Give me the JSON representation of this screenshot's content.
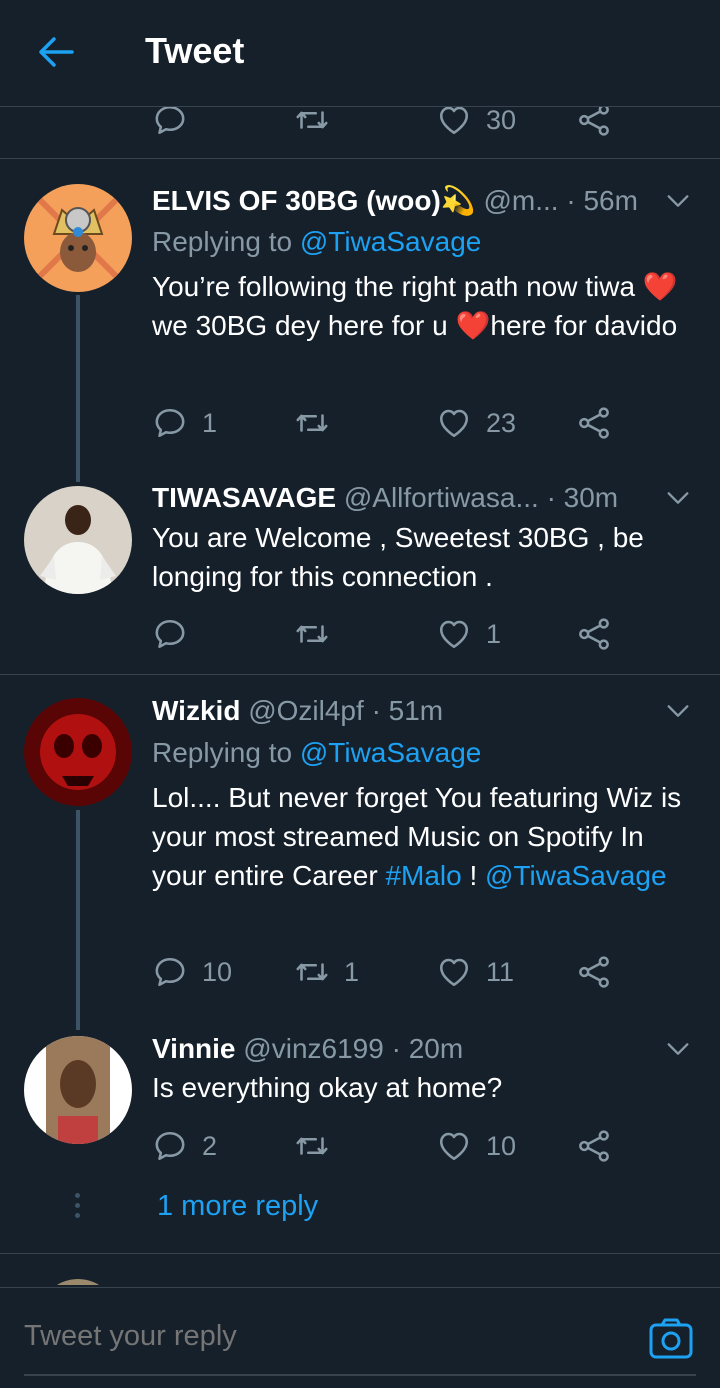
{
  "header": {
    "title": "Tweet"
  },
  "top_actions": {
    "like_count": "30"
  },
  "tweets": [
    {
      "name": "ELVIS OF 30BG (woo)",
      "name_emoji": "💫",
      "handle": "@m...",
      "time": "· 56m",
      "replying_prefix": "Replying to",
      "replying_to": "@TiwaSavage",
      "text_part1": "You’re following the right path now tiwa ",
      "heart1": "❤️",
      "text_part2": "we 30BG dey here for u ",
      "heart2": "❤️",
      "text_part3": "here for davido",
      "reply_count": "1",
      "retweet_count": "",
      "like_count": "23"
    },
    {
      "name": "TIWASAVAGE",
      "handle": "@Allfortiwasa...",
      "time": "· 30m",
      "text": "You are Welcome , Sweetest 30BG , be longing for this connection .",
      "reply_count": "",
      "retweet_count": "",
      "like_count": "1"
    },
    {
      "name": "Wizkid",
      "handle": "@Ozil4pf",
      "time": "· 51m",
      "replying_prefix": "Replying to",
      "replying_to": "@TiwaSavage",
      "text_part1": "Lol.... But never forget You featuring Wiz is your most streamed Music on Spotify In your entire Career ",
      "hashtag": "#Malo",
      "text_part2": " ! ",
      "mention": "@TiwaSavage",
      "reply_count": "10",
      "retweet_count": "1",
      "like_count": "11"
    },
    {
      "name": "Vinnie",
      "handle": "@vinz6199",
      "time": "· 20m",
      "text": "Is everything okay at home?",
      "reply_count": "2",
      "retweet_count": "",
      "like_count": "10"
    }
  ],
  "more_replies": "1 more reply",
  "reply_bar": {
    "placeholder": "Tweet your reply"
  },
  "colors": {
    "background": "#15202b",
    "accent": "#1da1f2",
    "muted": "#8899a6",
    "divider": "#38444d"
  }
}
